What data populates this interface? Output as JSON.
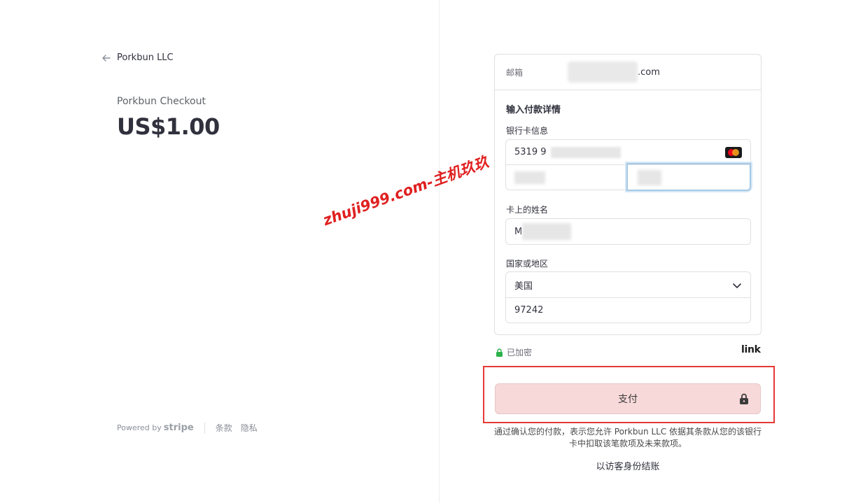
{
  "left": {
    "merchant": "Porkbun LLC",
    "product": "Porkbun Checkout",
    "price": "US$1.00",
    "footer": {
      "powered_by": "Powered by",
      "stripe": "stripe",
      "terms": "条款",
      "privacy": "隐私"
    }
  },
  "watermark": "zhuji999.com-主机玖玖",
  "form": {
    "email_label": "邮箱",
    "email_suffix": ".com",
    "section_title": "输入付款详情",
    "card_label": "银行卡信息",
    "card_prefix": "5319 9",
    "card_brand_icon": "mastercard-icon",
    "name_label": "卡上的姓名",
    "name_prefix": "M",
    "country_label": "国家或地区",
    "country_value": "美国",
    "zip_value": "97242"
  },
  "secure_text": "已加密",
  "link_logo": "link",
  "pay_button": "支付",
  "terms_text": "通过确认您的付款，表示您允许 Porkbun LLC 依据其条款从您的该银行卡中扣取该笔款项及未来款项。",
  "guest_checkout": "以访客身份结账",
  "colors": {
    "pay_bg": "#f8d9d9",
    "highlight": "#e53935",
    "secure_green": "#2cb34a",
    "focus_blue": "#a5c8e4"
  }
}
